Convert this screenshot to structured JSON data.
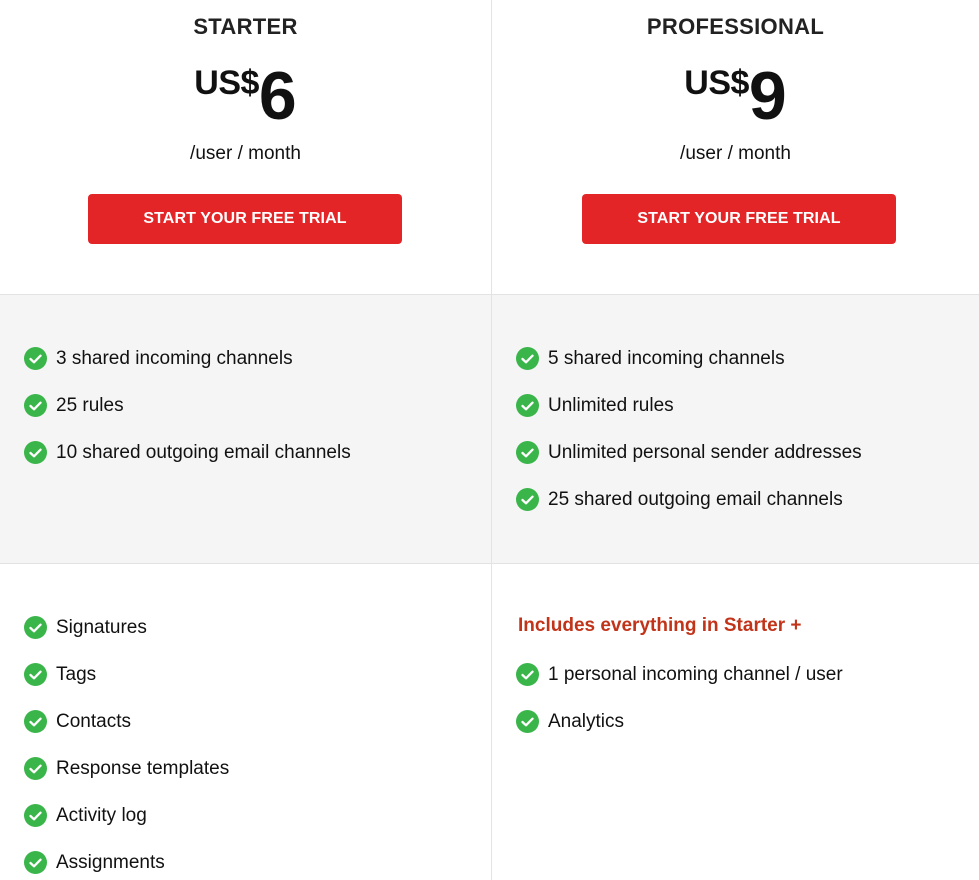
{
  "plans": [
    {
      "name": "STARTER",
      "currency": "US$",
      "amount": "6",
      "period": "/user / month",
      "cta_label": "START YOUR FREE TRIAL",
      "key_features": [
        "3 shared incoming channels",
        "25 rules",
        "10 shared outgoing email channels"
      ],
      "features": [
        "Signatures",
        "Tags",
        "Contacts",
        "Response templates",
        "Activity log",
        "Assignments"
      ]
    },
    {
      "name": "PROFESSIONAL",
      "currency": "US$",
      "amount": "9",
      "period": "/user / month",
      "cta_label": "START YOUR FREE TRIAL",
      "key_features": [
        "5 shared incoming channels",
        "Unlimited rules",
        "Unlimited personal sender addresses",
        "25 shared outgoing email channels"
      ],
      "includes_note": "Includes everything in Starter +",
      "features": [
        "1 personal incoming channel / user",
        "Analytics"
      ]
    }
  ],
  "colors": {
    "cta_background": "#e42527",
    "check": "#3ab54a",
    "includes_note": "#c2341a",
    "band_background": "#f5f5f5"
  },
  "icons": {
    "feature_bullet": "check-circle-icon"
  }
}
